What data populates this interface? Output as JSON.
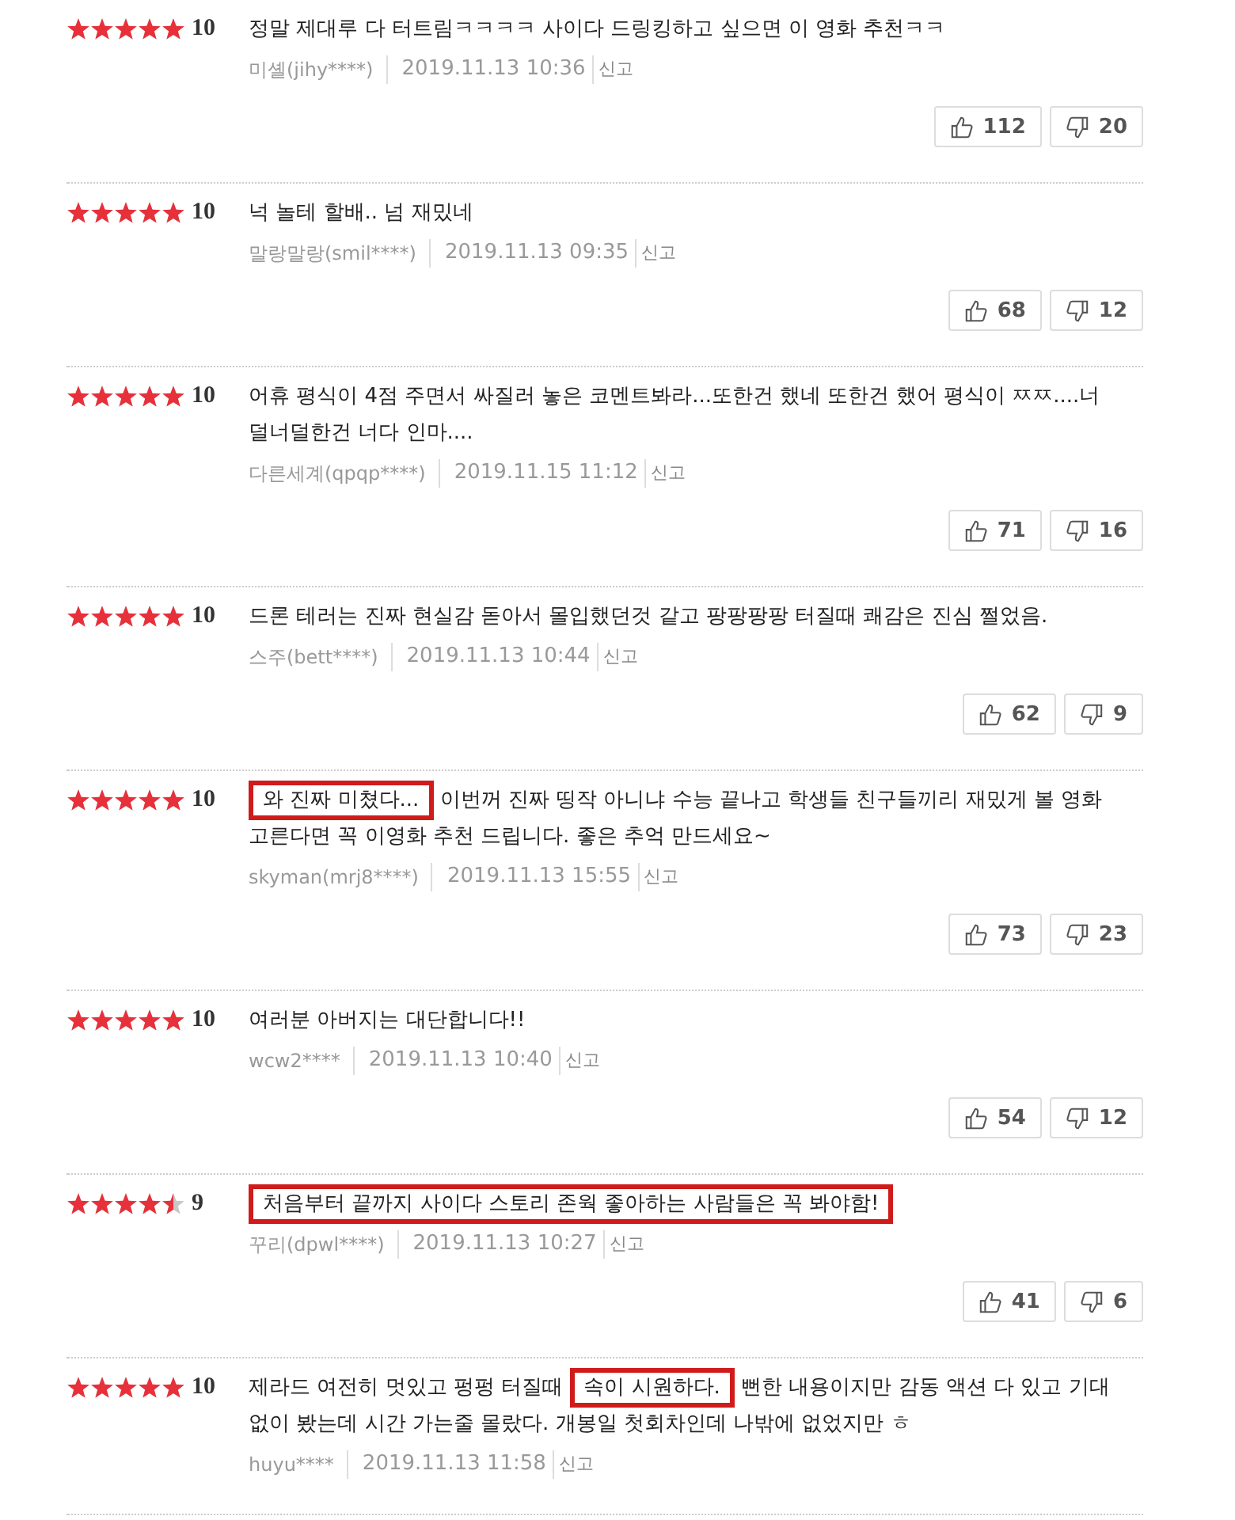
{
  "reviews": [
    {
      "stars": 5,
      "score": "10",
      "text_parts": [
        {
          "text": "정말 제대루 다 터트림ㅋㅋㅋㅋ 사이다 드링킹하고 싶으면 이 영화 추천ㅋㅋ",
          "highlighted": false
        }
      ],
      "author": "미셸(jihy****)",
      "date": "2019.11.13 10:36",
      "report": "신고",
      "likes": "112",
      "dislikes": "20"
    },
    {
      "stars": 5,
      "score": "10",
      "text_parts": [
        {
          "text": "넉 놀테 할배.. 넘 재밌네",
          "highlighted": false
        }
      ],
      "author": "말랑말랑(smil****)",
      "date": "2019.11.13 09:35",
      "report": "신고",
      "likes": "68",
      "dislikes": "12"
    },
    {
      "stars": 5,
      "score": "10",
      "text_parts": [
        {
          "text": "어휴 평식이 4점 주면서 싸질러 놓은 코멘트봐라...또한건 했네 또한건 했어 평식이 ㅉㅉ....너덜너덜한건 너다 인마....",
          "highlighted": false
        }
      ],
      "author": "다른세계(qpqp****)",
      "date": "2019.11.15 11:12",
      "report": "신고",
      "likes": "71",
      "dislikes": "16"
    },
    {
      "stars": 5,
      "score": "10",
      "text_parts": [
        {
          "text": "드론 테러는 진짜 현실감 돋아서 몰입했던것 같고 팡팡팡팡 터질때 쾌감은 진심 쩔었음.",
          "highlighted": false
        }
      ],
      "author": "스주(bett****)",
      "date": "2019.11.13 10:44",
      "report": "신고",
      "likes": "62",
      "dislikes": "9"
    },
    {
      "stars": 5,
      "score": "10",
      "text_parts": [
        {
          "text": "와 진짜 미쳤다...",
          "highlighted": true
        },
        {
          "text": " 이번꺼 진짜 띵작 아니냐 수능 끝나고 학생들 친구들끼리 재밌게 볼 영화 고른다면 꼭 이영화 추천 드립니다. 좋은 추억 만드세요~",
          "highlighted": false
        }
      ],
      "author": "skyman(mrj8****)",
      "date": "2019.11.13 15:55",
      "report": "신고",
      "likes": "73",
      "dislikes": "23"
    },
    {
      "stars": 5,
      "score": "10",
      "text_parts": [
        {
          "text": "여러분 아버지는 대단합니다!!",
          "highlighted": false
        }
      ],
      "author": "wcw2****",
      "date": "2019.11.13 10:40",
      "report": "신고",
      "likes": "54",
      "dislikes": "12"
    },
    {
      "stars": 4.5,
      "score": "9",
      "text_parts": [
        {
          "text": "처음부터 끝까지 사이다 스토리 존웍 좋아하는 사람들은 꼭 봐야함!",
          "highlighted": true
        }
      ],
      "author": "꾸리(dpwl****)",
      "date": "2019.11.13 10:27",
      "report": "신고",
      "likes": "41",
      "dislikes": "6"
    },
    {
      "stars": 5,
      "score": "10",
      "text_parts": [
        {
          "text": "제라드 여전히 멋있고 펑펑 터질때 ",
          "highlighted": false
        },
        {
          "text": "속이 시원하다.",
          "highlighted": true
        },
        {
          "text": " 뻔한 내용이지만 감동 액션 다 있고 기대 없이 봤는데 시간 가는줄 몰랐다. 개봉일 첫회차인데 나밖에 없었지만 ㅎ",
          "highlighted": false
        }
      ],
      "author": "huyu****",
      "date": "2019.11.13 11:58",
      "report": "신고"
    }
  ]
}
